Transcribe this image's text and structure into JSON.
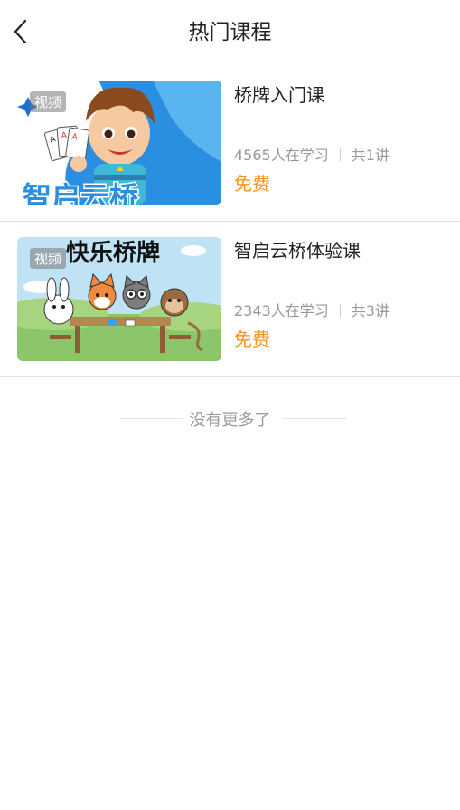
{
  "header": {
    "title": "热门课程",
    "back_icon": "chevron-left-icon"
  },
  "courses": [
    {
      "tag": "视频",
      "name": "桥牌入门课",
      "learners": "4565人在学习",
      "lessons": "共1讲",
      "price": "免费",
      "thumb_text": "智启云桥"
    },
    {
      "tag": "视频",
      "name": "智启云桥体验课",
      "learners": "2343人在学习",
      "lessons": "共3讲",
      "price": "免费",
      "thumb_text": "快乐桥牌"
    }
  ],
  "footer": {
    "no_more": "没有更多了"
  },
  "colors": {
    "price": "#f7931e",
    "divider": "#e2e2e2",
    "muted": "#999999"
  }
}
